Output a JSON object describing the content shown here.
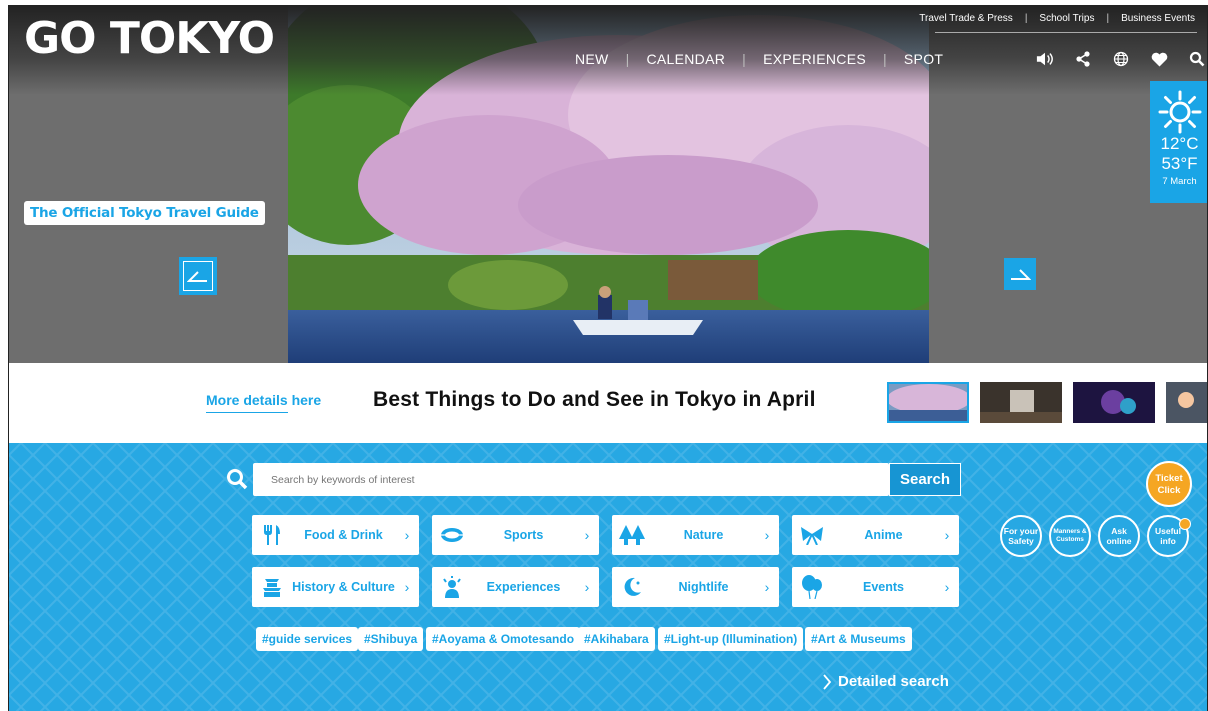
{
  "logo": {
    "wordmark": "GO TOKYO",
    "tagline": "The Official Tokyo Travel Guide"
  },
  "util_links": [
    "Travel Trade & Press",
    "School Trips",
    "Business Events"
  ],
  "main_nav": [
    "NEW",
    "CALENDAR",
    "EXPERIENCES",
    "SPOT"
  ],
  "icons": [
    "speaker-icon",
    "share-icon",
    "globe-icon",
    "heart-icon",
    "search-icon"
  ],
  "weather": {
    "icon": "sun-icon",
    "celsius": "12°C",
    "fahrenheit": "53°F",
    "date": "7 March"
  },
  "feature": {
    "more_link": "More details here",
    "title": "Best Things to Do and See in Tokyo in April"
  },
  "search": {
    "placeholder": "Search by keywords of interest",
    "button": "Search"
  },
  "categories": [
    {
      "label": "Food & Drink",
      "icon": "fork-knife-icon"
    },
    {
      "label": "Sports",
      "icon": "stadium-icon"
    },
    {
      "label": "Nature",
      "icon": "trees-icon"
    },
    {
      "label": "Anime",
      "icon": "ribbon-icon"
    },
    {
      "label": "History & Culture",
      "icon": "castle-icon"
    },
    {
      "label": "Experiences",
      "icon": "person-sparkle-icon"
    },
    {
      "label": "Nightlife",
      "icon": "moon-icon"
    },
    {
      "label": "Events",
      "icon": "balloon-icon"
    }
  ],
  "tags": [
    "#guide services",
    "#Shibuya",
    "#Aoyama & Omotesando",
    "#Akihabara",
    "#Light-up (Illumination)",
    "#Art & Museums"
  ],
  "detailed_search": "Detailed search",
  "ticket": {
    "line1": "Ticket",
    "line2": "Click"
  },
  "quick_links": [
    {
      "line1": "For your",
      "line2": "Safety"
    },
    {
      "line1": "Manners &",
      "line2": "Customs"
    },
    {
      "line1": "Ask",
      "line2": "online"
    },
    {
      "line1": "Useful",
      "line2": "info"
    }
  ],
  "colors": {
    "brand_blue": "#1aa5e6",
    "ticket_orange": "#f5a623"
  }
}
